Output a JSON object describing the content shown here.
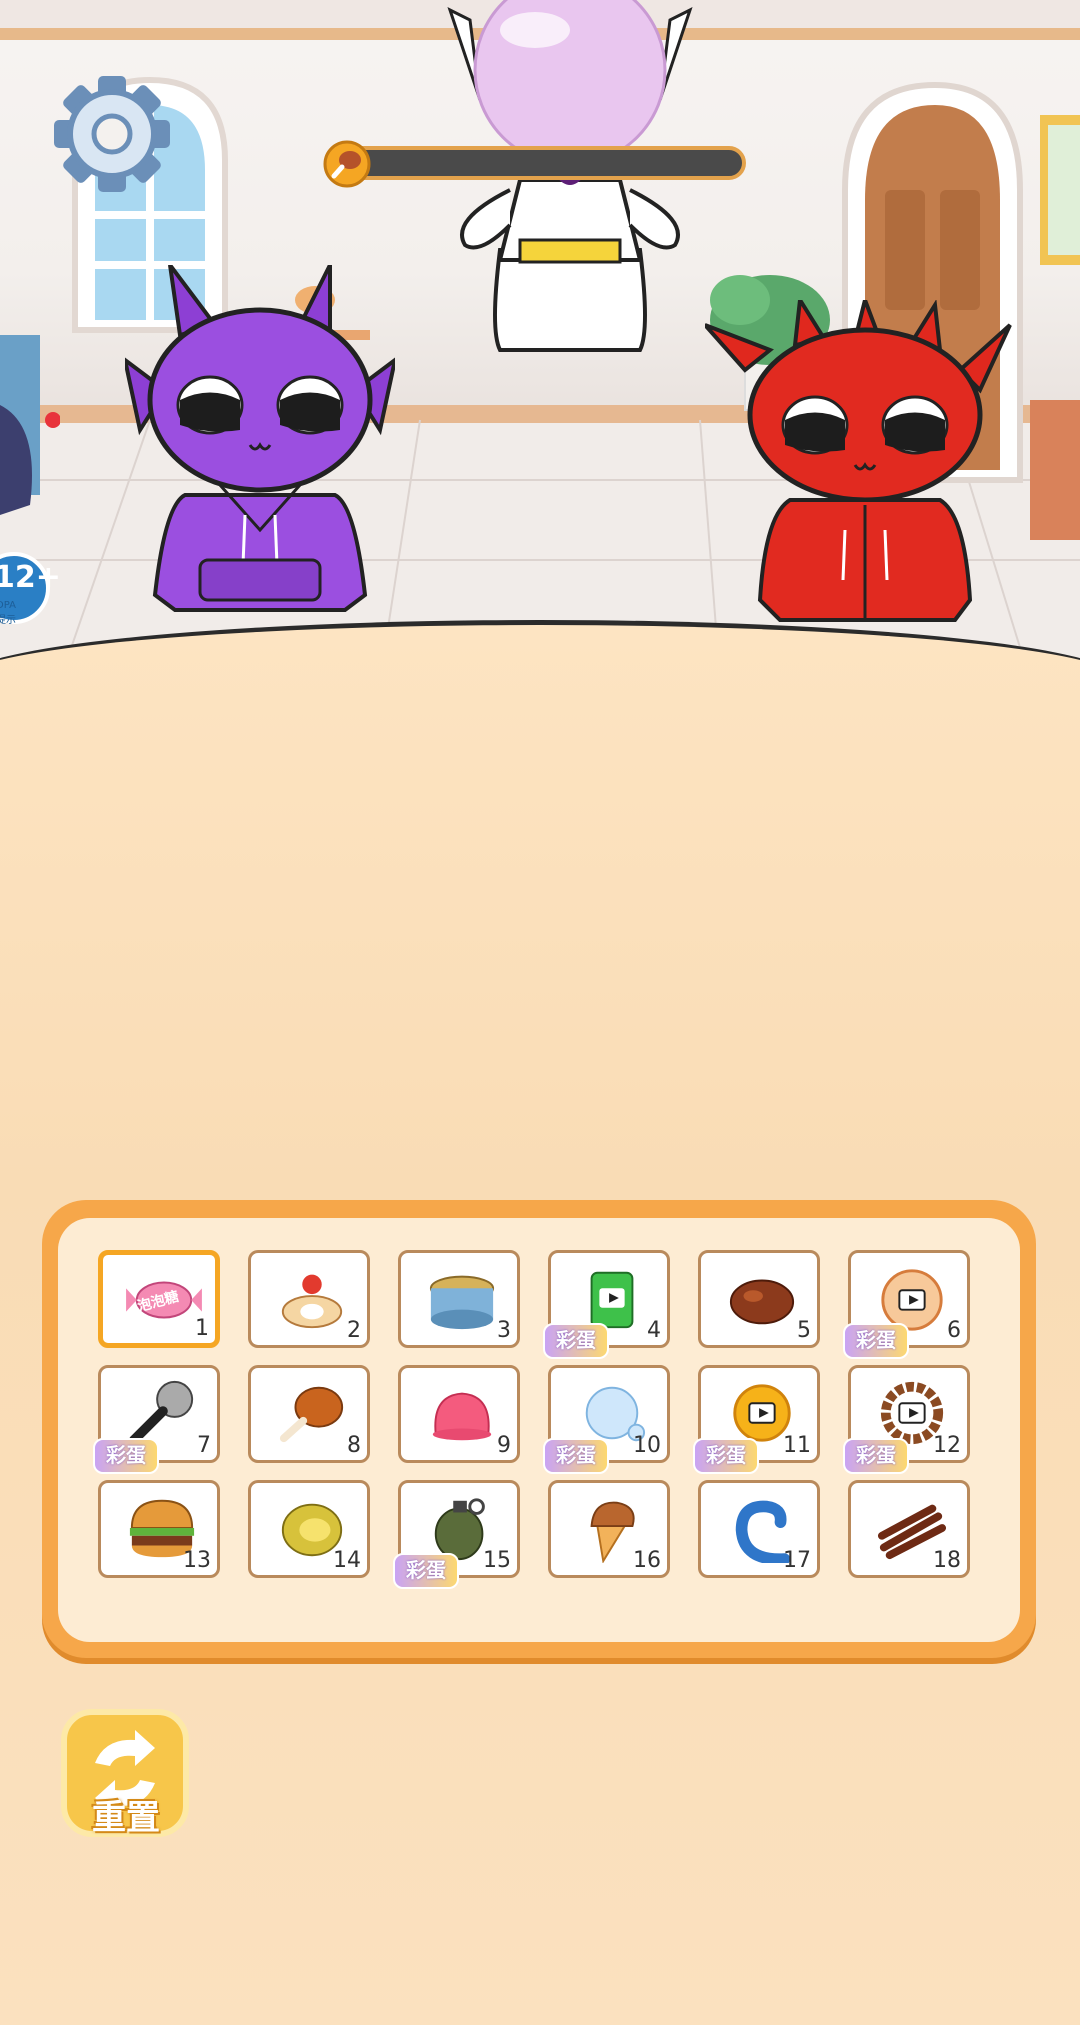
{
  "hud": {
    "hunger_progress": 0.0,
    "settings_icon": "gear-icon",
    "hunger_icon": "drumstick-icon"
  },
  "age_badge": {
    "age": "12+",
    "sub1": "DPA",
    "sub2": "提示"
  },
  "food_grid": {
    "items": [
      {
        "num": "1",
        "name": "candy",
        "selected": true,
        "ad_tag": false,
        "candy_text": "泡泡糖"
      },
      {
        "num": "2",
        "name": "cake-roll",
        "selected": false,
        "ad_tag": false
      },
      {
        "num": "3",
        "name": "cat-food-can",
        "selected": false,
        "ad_tag": false
      },
      {
        "num": "4",
        "name": "green-can",
        "selected": false,
        "ad_tag": true
      },
      {
        "num": "5",
        "name": "roast-chicken",
        "selected": false,
        "ad_tag": false
      },
      {
        "num": "6",
        "name": "peach",
        "selected": false,
        "ad_tag": true
      },
      {
        "num": "7",
        "name": "microphone",
        "selected": false,
        "ad_tag": true
      },
      {
        "num": "8",
        "name": "drumstick",
        "selected": false,
        "ad_tag": false
      },
      {
        "num": "9",
        "name": "jelly",
        "selected": false,
        "ad_tag": false
      },
      {
        "num": "10",
        "name": "water-bubble",
        "selected": false,
        "ad_tag": true
      },
      {
        "num": "11",
        "name": "sun",
        "selected": false,
        "ad_tag": true
      },
      {
        "num": "12",
        "name": "prayer-beads",
        "selected": false,
        "ad_tag": true
      },
      {
        "num": "13",
        "name": "burger",
        "selected": false,
        "ad_tag": false
      },
      {
        "num": "14",
        "name": "durian",
        "selected": false,
        "ad_tag": false
      },
      {
        "num": "15",
        "name": "grenade",
        "selected": false,
        "ad_tag": true
      },
      {
        "num": "16",
        "name": "ice-cream",
        "selected": false,
        "ad_tag": false
      },
      {
        "num": "17",
        "name": "tentacle",
        "selected": false,
        "ad_tag": false
      },
      {
        "num": "18",
        "name": "jerky",
        "selected": false,
        "ad_tag": false
      }
    ],
    "ad_tag_label": "彩蛋"
  },
  "reset_button": {
    "label": "重置"
  }
}
